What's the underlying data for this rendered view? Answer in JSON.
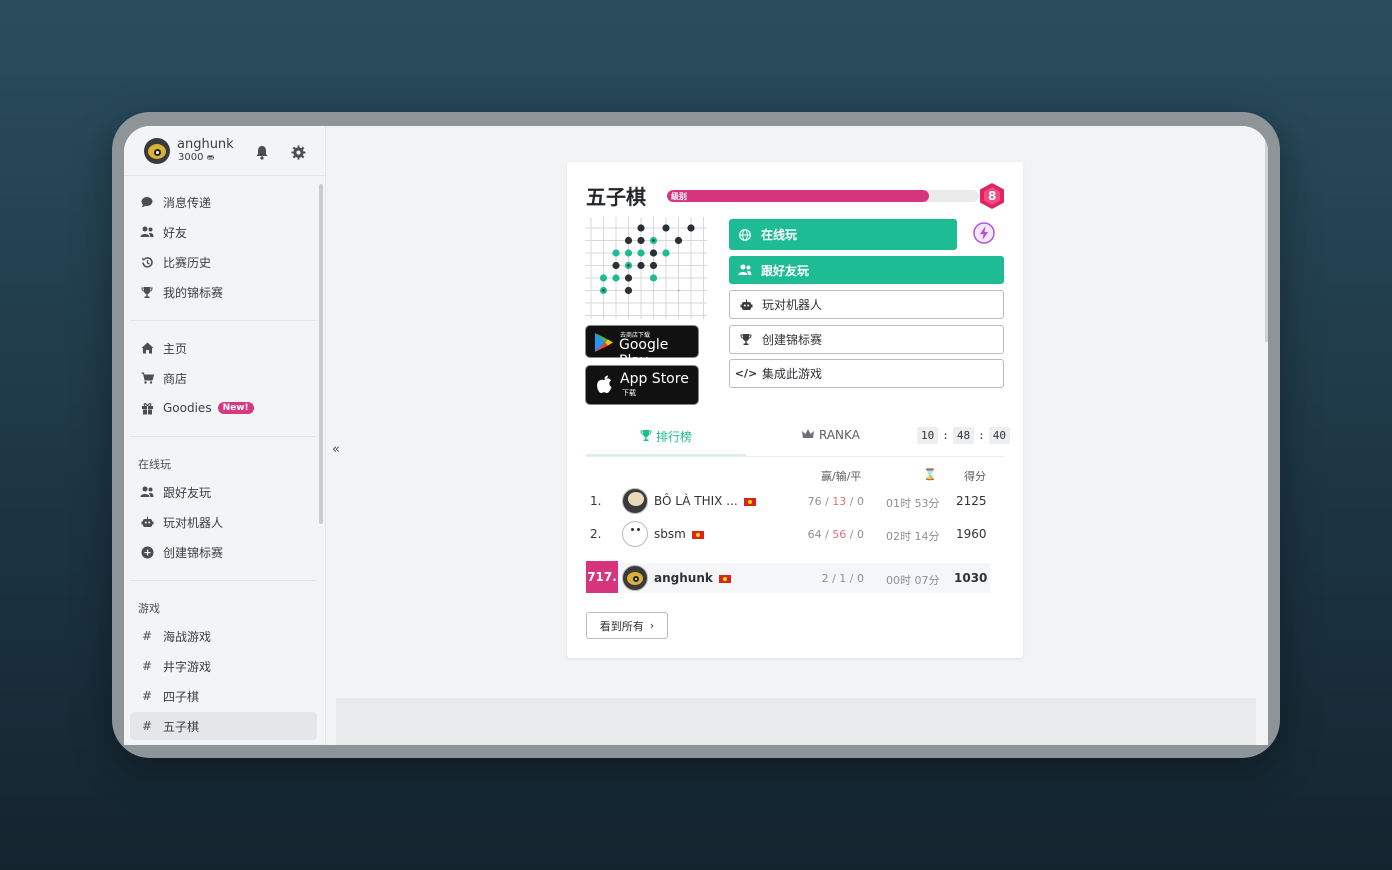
{
  "user": {
    "name": "anghunk",
    "coins": "3000"
  },
  "nav": {
    "section1": [
      {
        "label": "消息传递",
        "icon": "chat-icon"
      },
      {
        "label": "好友",
        "icon": "friends-icon"
      },
      {
        "label": "比赛历史",
        "icon": "history-icon"
      },
      {
        "label": "我的锦标赛",
        "icon": "trophy-icon"
      }
    ],
    "section2": [
      {
        "label": "主页",
        "icon": "home-icon"
      },
      {
        "label": "商店",
        "icon": "cart-icon"
      },
      {
        "label": "Goodies",
        "icon": "gift-icon",
        "badge": "New!"
      }
    ],
    "play_heading": "在线玩",
    "section3": [
      {
        "label": "跟好友玩",
        "icon": "friends-icon"
      },
      {
        "label": "玩对机器人",
        "icon": "robot-icon"
      },
      {
        "label": "创建锦标赛",
        "icon": "plus-circle-icon"
      }
    ],
    "games_heading": "游戏",
    "games": [
      {
        "label": "海战游戏",
        "icon": "hash-icon"
      },
      {
        "label": "井字游戏",
        "icon": "hash-icon"
      },
      {
        "label": "四子棋",
        "icon": "hash-icon"
      },
      {
        "label": "五子棋",
        "icon": "hash-icon",
        "active": true
      }
    ]
  },
  "game": {
    "title": "五子棋",
    "level_label": "级别",
    "level_value": "8",
    "level_progress": 0.84,
    "google_play_small": "去商店下载",
    "google_play_big": "Google Play",
    "app_store_big": "App Store",
    "app_store_small": "下载",
    "btn_online": "在线玩",
    "btn_friends": "跟好友玩",
    "btn_robot": "玩对机器人",
    "btn_tournament": "创建锦标赛",
    "btn_embed": "集成此游戏"
  },
  "leaderboard": {
    "tab_active": "排行榜",
    "tab_ranka": "RANKA",
    "timer": [
      "10",
      "48",
      "40"
    ],
    "col_wld": "赢/输/平",
    "col_score": "得分",
    "rows": [
      {
        "rank": "1.",
        "name": "BÔ LÀ THIX ...",
        "wins": "76",
        "losses": "13",
        "draws": "0",
        "time": "01时 53分",
        "score": "2125"
      },
      {
        "rank": "2.",
        "name": "sbsm",
        "wins": "64",
        "losses": "56",
        "draws": "0",
        "time": "02时 14分",
        "score": "1960"
      }
    ],
    "me": {
      "rank": "717.",
      "name": "anghunk",
      "wins": "2",
      "losses": "1",
      "draws": "0",
      "time": "00时 07分",
      "score": "1030"
    },
    "see_all": "看到所有"
  },
  "colors": {
    "accent": "#1ebc94",
    "brand": "#d6357e"
  }
}
